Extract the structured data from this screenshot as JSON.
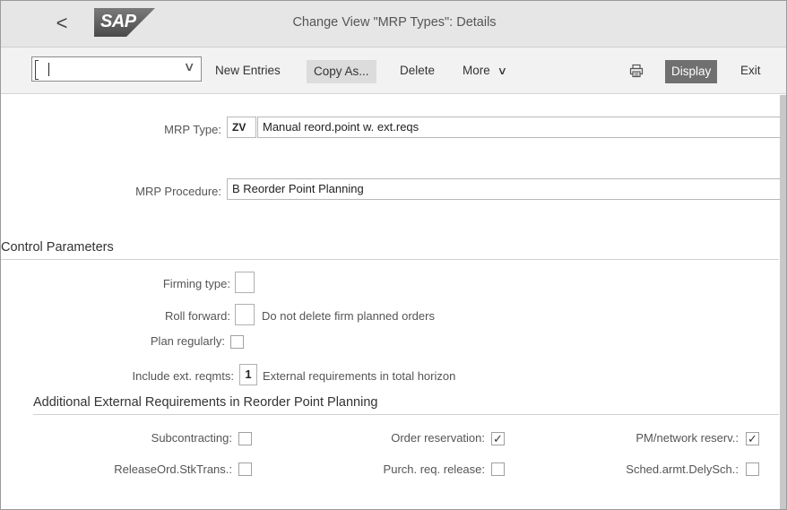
{
  "shell": {
    "title": "Change View \"MRP Types\": Details",
    "back_glyph": "<",
    "logo_text": "SAP"
  },
  "toolbar": {
    "command_value": "",
    "new_entries": "New Entries",
    "copy_as": "Copy As...",
    "delete": "Delete",
    "more": "More",
    "display": "Display",
    "exit": "Exit"
  },
  "header": {
    "mrp_type_label": "MRP Type:",
    "mrp_type_code": "ZV",
    "mrp_type_desc": "Manual reord.point w. ext.reqs",
    "mrp_procedure_label": "MRP Procedure:",
    "mrp_procedure_value": "B Reorder Point Planning"
  },
  "control": {
    "title": "Control Parameters",
    "firming_type_label": "Firming type:",
    "firming_type_value": "",
    "roll_forward_label": "Roll forward:",
    "roll_forward_value": "",
    "roll_forward_desc": "Do not delete firm planned orders",
    "plan_regularly_label": "Plan regularly:",
    "plan_regularly_checked": false,
    "include_ext_label": "Include ext. reqmts:",
    "include_ext_value": "1",
    "include_ext_desc": "External requirements in total horizon"
  },
  "additional": {
    "title": "Additional External Requirements in Reorder Point Planning",
    "subcontracting_label": "Subcontracting:",
    "subcontracting_checked": false,
    "order_reservation_label": "Order reservation:",
    "order_reservation_checked": true,
    "pm_network_label": "PM/network reserv.:",
    "pm_network_checked": true,
    "release_ord_label": "ReleaseOrd.StkTrans.:",
    "release_ord_checked": false,
    "purch_req_label": "Purch. req. release:",
    "purch_req_checked": false,
    "sched_agmt_label": "Sched.armt.DelySch.:",
    "sched_agmt_checked": false
  },
  "colors": {
    "shellbar_bg": "#e6e6e6",
    "toolbar_bg": "#f2f2f2",
    "logo_blue": "#5a5a5a",
    "display_btn_bg": "#707070"
  },
  "icons": {
    "back": "chevron-left-icon",
    "dropdown": "chevron-down-icon",
    "print": "printer-icon",
    "more": "chevron-down-icon"
  }
}
